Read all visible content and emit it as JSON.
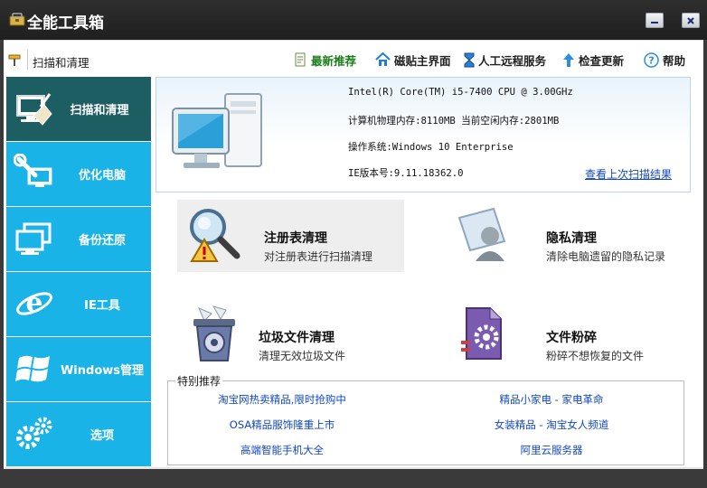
{
  "window": {
    "title": "全能工具箱",
    "icons": {
      "app": "toolbox-icon",
      "minimize": "minimize-icon",
      "close": "close-icon"
    }
  },
  "toolbar": {
    "location": "扫描和清理",
    "links": {
      "recommend": "最新推荐",
      "home": "磁贴主界面",
      "remote": "人工远程服务",
      "update": "检查更新",
      "help": "帮助"
    }
  },
  "sidebar": {
    "items": [
      {
        "label": "扫描和清理",
        "icon": "broom-pc-icon",
        "active": true
      },
      {
        "label": "优化电脑",
        "icon": "wrench-pc-icon",
        "active": false
      },
      {
        "label": "备份还原",
        "icon": "monitors-icon",
        "active": false
      },
      {
        "label": "IE工具",
        "icon": "ie-icon",
        "active": false
      },
      {
        "label": "Windows管理",
        "icon": "windows-logo-icon",
        "active": false
      },
      {
        "label": "选项",
        "icon": "gears-icon",
        "active": false
      }
    ]
  },
  "system_info": {
    "cpu": "Intel(R) Core(TM) i5-7400 CPU @ 3.00GHz",
    "memory": "计算机物理内存:8110MB  当前空闲内存:2801MB",
    "os": "操作系统:Windows 10 Enterprise",
    "ie": "IE版本号:9.11.18362.0",
    "last_scan_link": "查看上次扫描结果"
  },
  "tiles": [
    {
      "title": "注册表清理",
      "desc": "对注册表进行扫描清理",
      "icon": "registry-magnifier-icon"
    },
    {
      "title": "隐私清理",
      "desc": "清除电脑遗留的隐私记录",
      "icon": "privacy-user-icon"
    },
    {
      "title": "垃圾文件清理",
      "desc": "清理无效垃圾文件",
      "icon": "trash-bin-icon"
    },
    {
      "title": "文件粉碎",
      "desc": "粉碎不想恢复的文件",
      "icon": "file-shredder-icon"
    }
  ],
  "recommendations": {
    "title": "特别推荐",
    "left": [
      "淘宝网热卖精品,限时抢购中",
      "OSA精品服饰隆重上市",
      "高端智能手机大全"
    ],
    "right": [
      "精品小家电 - 家电革命",
      "女装精品 - 淘宝女人频道",
      "阿里云服务器"
    ]
  },
  "colors": {
    "sidebar": "#1ab3e8",
    "sidebar_active": "#1d5e62",
    "link": "#1147c2",
    "titlebar": "#262626",
    "recommend_text": "#1a7d1a"
  }
}
